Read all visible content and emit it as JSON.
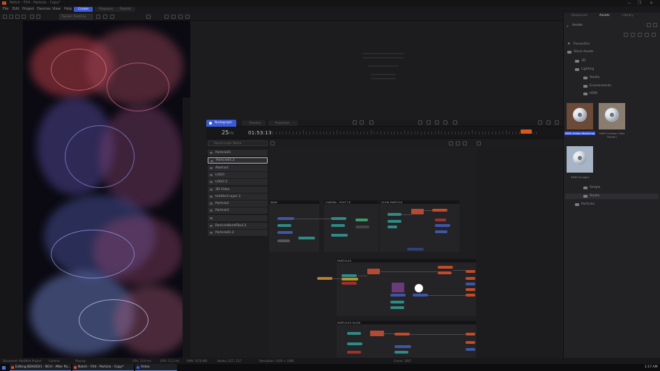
{
  "titlebar": {
    "title": "Notch - FX4 - Particle - Copy*",
    "controls": [
      "—",
      "❐",
      "✕"
    ]
  },
  "menubar": {
    "items": [
      "File",
      "Edit",
      "Project",
      "Devices",
      "View",
      "Help"
    ],
    "workspaces": [
      {
        "label": "Create",
        "active": true
      },
      {
        "label": "Playback",
        "active": false
      },
      {
        "label": "Publish",
        "active": false
      }
    ]
  },
  "toolbar": {
    "render_field": "Render: Realtime"
  },
  "nodegraph": {
    "tab_label": "Nodegraph",
    "other_tabs": [
      "Timeline",
      "Properties"
    ],
    "fps": "25",
    "fps_unit": "FPS",
    "timecode": "01:53:13",
    "layer_search_placeholder": "Search Layer Name",
    "layers": [
      {
        "name": "Particle01",
        "selected": false
      },
      {
        "name": "Particle01.2",
        "selected": true
      },
      {
        "name": "Abstract",
        "selected": false
      },
      {
        "name": "LOGO",
        "selected": false
      },
      {
        "name": "LOGO 2",
        "selected": false
      },
      {
        "name": "3D Video",
        "selected": false
      },
      {
        "name": "Untitled Layer 2",
        "selected": false
      },
      {
        "name": "Particle2",
        "selected": false
      },
      {
        "name": "Particle3",
        "selected": false
      },
      {
        "name": "",
        "selected": false
      },
      {
        "name": "ParticleWorldFibril.2",
        "selected": false
      },
      {
        "name": "Particle01.2",
        "selected": false
      }
    ],
    "groups": [
      {
        "label": "MAIN"
      },
      {
        "label": "CAMERA - POST FX"
      },
      {
        "label": "GLOW PARTICLE"
      },
      {
        "label": "PARTICLES"
      },
      {
        "label": "PARTICLES GLOW"
      }
    ]
  },
  "right_panel": {
    "tabs": [
      {
        "label": "Resources",
        "active": false
      },
      {
        "label": "Assets",
        "active": true
      },
      {
        "label": "Library",
        "active": false
      }
    ],
    "search_value": "Assets",
    "tree": [
      {
        "label": "Favourites",
        "depth": 0
      },
      {
        "label": "Stock Assets",
        "depth": 0
      },
      {
        "label": "3D",
        "depth": 1
      },
      {
        "label": "Lighting",
        "depth": 1
      },
      {
        "label": "Studio",
        "depth": 2
      },
      {
        "label": "Environments",
        "depth": 2
      },
      {
        "label": "HDRI",
        "depth": 2
      }
    ],
    "thumbnails": [
      {
        "label": "HDRI Artists Workshop",
        "selected": true
      },
      {
        "label": "HDRI Outdoor (Poly Haven)",
        "selected": false
      },
      {
        "label": "HDRI Sunlight",
        "selected": false
      }
    ],
    "tree_after": [
      {
        "label": "Simple",
        "depth": 2
      },
      {
        "label": "Studio",
        "depth": 2,
        "highlight": true
      },
      {
        "label": "Particles",
        "depth": 1
      }
    ]
  },
  "statusbar": {
    "items": [
      "Document: Modified Project",
      "Camera",
      "Playing",
      "CPU: 13.0 ms",
      "GPU: 11.2 ms",
      "RAM: 3276 MB",
      "Nodes: 227 / 227",
      "Resolution: 1920 × 1080",
      "Frame: 1697"
    ]
  },
  "taskbar": {
    "tasks": [
      {
        "label": "Editing BDH2021 - NCH - After Pa...",
        "color": "#d94b2b"
      },
      {
        "label": "Notch - FX4 - Particle - Copy*",
        "color": "#d94b2b"
      },
      {
        "label": "Video",
        "color": "#3a5bd8"
      }
    ],
    "clock": "1:17 AM"
  },
  "colors": {
    "accent": "#3a5bd8",
    "playhead": "#d65a1c"
  }
}
